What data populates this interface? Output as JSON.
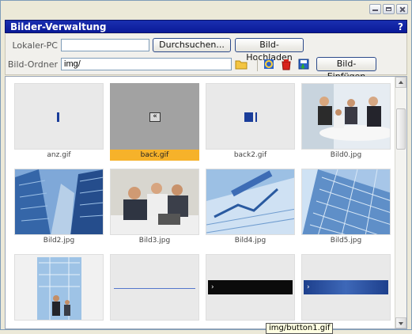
{
  "window": {
    "title": "Bilder-Verwaltung",
    "help": "?"
  },
  "toolbar": {
    "local_label": "Lokaler-PC",
    "local_value": "",
    "browse_label": "Durchsuchen...",
    "upload_label": "Bild-Hochladen",
    "folder_label": "Bild-Ordner",
    "folder_value": "img/",
    "insert_label": "Bild-Einfügen",
    "icons": [
      "folder-icon",
      "refresh-icon",
      "delete-icon",
      "save-icon"
    ]
  },
  "gallery": {
    "items": [
      {
        "name": "anz.gif",
        "kind": "marker"
      },
      {
        "name": "back.gif",
        "kind": "back",
        "selected": true
      },
      {
        "name": "back2.gif",
        "kind": "back2"
      },
      {
        "name": "Bild0.jpg",
        "kind": "photo-meeting"
      },
      {
        "name": "Bild2.jpg",
        "kind": "photo-building"
      },
      {
        "name": "Bild3.jpg",
        "kind": "photo-team"
      },
      {
        "name": "Bild4.jpg",
        "kind": "photo-chart"
      },
      {
        "name": "Bild5.jpg",
        "kind": "photo-glass"
      },
      {
        "name": "",
        "kind": "photo-lobby"
      },
      {
        "name": "",
        "kind": "line"
      },
      {
        "name": "",
        "kind": "black-bar"
      },
      {
        "name": "",
        "kind": "blue-bar"
      }
    ]
  },
  "tooltip": "img/button1.gif",
  "colors": {
    "title_bg": "#0a1a98",
    "selected_caption": "#f6b22a"
  }
}
